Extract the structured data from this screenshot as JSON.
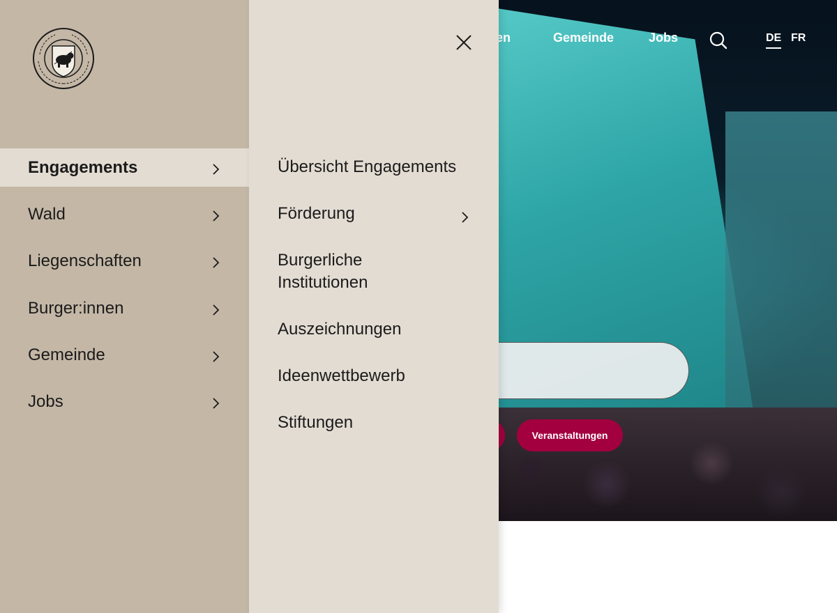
{
  "logo": {
    "text": "BURGERGEMEINDE BERN",
    "icon": "bern-bear-seal-icon"
  },
  "topnav": {
    "partial_link": "nen",
    "links": [
      "Gemeinde",
      "Jobs"
    ],
    "search_icon": "search-icon",
    "languages": [
      {
        "code": "DE",
        "active": true
      },
      {
        "code": "FR",
        "active": false
      }
    ]
  },
  "close_icon": "close-icon",
  "menu": {
    "items": [
      {
        "label": "Engagements",
        "active": true,
        "icon": "chevron-right-icon"
      },
      {
        "label": "Wald",
        "active": false,
        "icon": "chevron-right-icon"
      },
      {
        "label": "Liegenschaften",
        "active": false,
        "icon": "chevron-right-icon"
      },
      {
        "label": "Burger:innen",
        "active": false,
        "icon": "chevron-right-icon"
      },
      {
        "label": "Gemeinde",
        "active": false,
        "icon": "chevron-right-icon"
      },
      {
        "label": "Jobs",
        "active": false,
        "icon": "chevron-right-icon"
      }
    ]
  },
  "submenu": {
    "items": [
      {
        "label": "Übersicht Engagements",
        "has_children": false
      },
      {
        "label": "Förderung",
        "has_children": true,
        "icon": "chevron-right-icon"
      },
      {
        "label": "Burgerliche Institutionen",
        "has_children": false
      },
      {
        "label": "Auszeichnungen",
        "has_children": false
      },
      {
        "label": "Ideenwettbewerb",
        "has_children": false
      },
      {
        "label": "Stiftungen",
        "has_children": false
      }
    ]
  },
  "hero": {
    "pill_label": "Veranstaltungen"
  },
  "colors": {
    "panel_left": "#c4b7a6",
    "panel_right": "#e3dcd2",
    "accent": "#a3003f",
    "text": "#1b1b1b"
  }
}
